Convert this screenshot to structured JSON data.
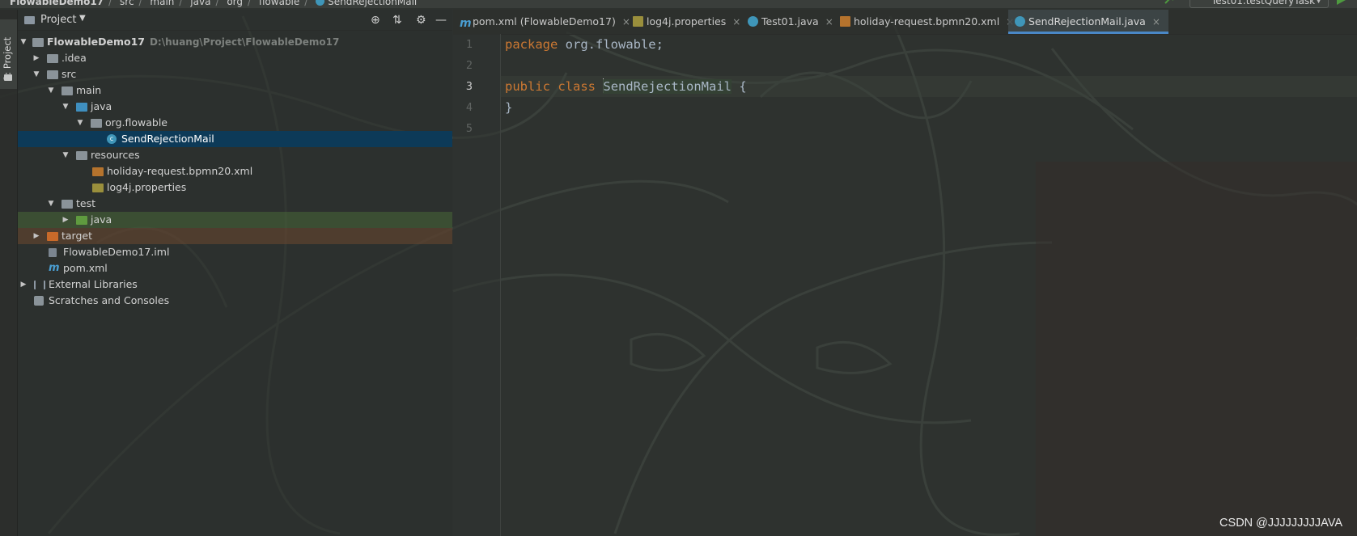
{
  "breadcrumb": {
    "items": [
      "FlowableDemo17",
      "src",
      "main",
      "java",
      "org",
      "flowable",
      "SendRejectionMail"
    ]
  },
  "run_config": {
    "label": "Test01.testQueryTask"
  },
  "tool_window": {
    "tab_label": "1: Project"
  },
  "project_panel": {
    "title": "Project",
    "tree": [
      {
        "label": "FlowableDemo17",
        "hint": "D:\\huang\\Project\\FlowableDemo17"
      },
      {
        "label": ".idea"
      },
      {
        "label": "src"
      },
      {
        "label": "main"
      },
      {
        "label": "java"
      },
      {
        "label": "org.flowable"
      },
      {
        "label": "SendRejectionMail"
      },
      {
        "label": "resources"
      },
      {
        "label": "holiday-request.bpmn20.xml"
      },
      {
        "label": "log4j.properties"
      },
      {
        "label": "test"
      },
      {
        "label": "java"
      },
      {
        "label": "target"
      },
      {
        "label": "FlowableDemo17.iml"
      },
      {
        "label": "pom.xml"
      },
      {
        "label": "External Libraries"
      },
      {
        "label": "Scratches and Consoles"
      }
    ]
  },
  "editor": {
    "tabs": [
      {
        "label": "pom.xml (FlowableDemo17)"
      },
      {
        "label": "log4j.properties"
      },
      {
        "label": "Test01.java"
      },
      {
        "label": "holiday-request.bpmn20.xml"
      },
      {
        "label": "SendRejectionMail.java"
      }
    ],
    "line_numbers": [
      "1",
      "2",
      "3",
      "4",
      "5"
    ],
    "code": {
      "l1_kw": "package",
      "l1_rest": " org.flowable;",
      "l3_kw1": "public",
      "l3_kw2": "class",
      "l3_class": "SendRejectionMail",
      "l3_brace": " {",
      "l4": "}"
    }
  },
  "watermark": "CSDN @JJJJJJJJJAVA",
  "colors": {
    "keyword": "#cc7832",
    "selection": "#0d3a58",
    "active_tab_underline": "#4a88c7"
  }
}
